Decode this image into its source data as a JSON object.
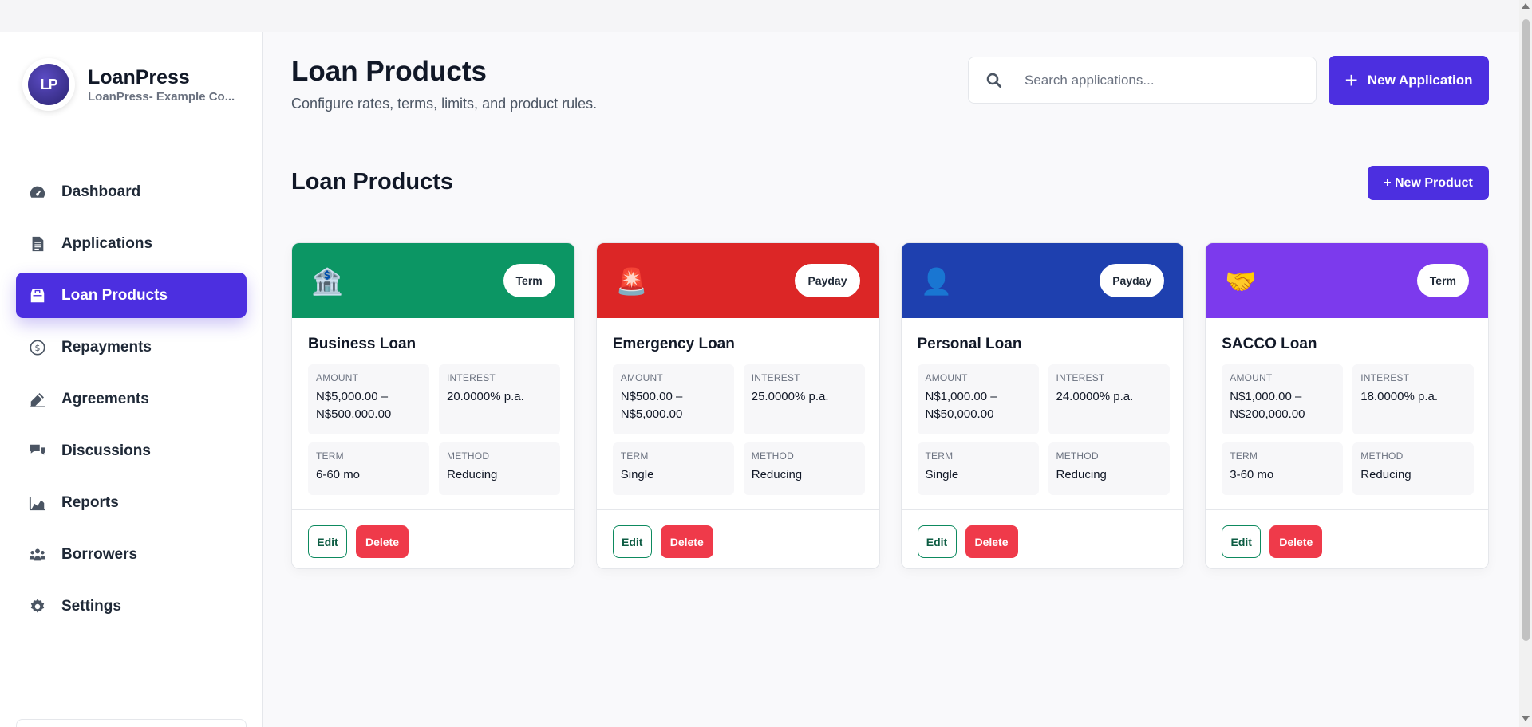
{
  "brand": {
    "logo_text": "LP",
    "name": "LoanPress",
    "subtitle": "LoanPress- Example Co..."
  },
  "sidebar": {
    "items": [
      {
        "label": "Dashboard",
        "icon": "gauge-icon",
        "active": false
      },
      {
        "label": "Applications",
        "icon": "document-icon",
        "active": false
      },
      {
        "label": "Loan Products",
        "icon": "store-icon",
        "active": true
      },
      {
        "label": "Repayments",
        "icon": "dollar-circle-icon",
        "active": false
      },
      {
        "label": "Agreements",
        "icon": "signature-icon",
        "active": false
      },
      {
        "label": "Discussions",
        "icon": "chat-icon",
        "active": false
      },
      {
        "label": "Reports",
        "icon": "chart-area-icon",
        "active": false
      },
      {
        "label": "Borrowers",
        "icon": "users-icon",
        "active": false
      },
      {
        "label": "Settings",
        "icon": "gear-icon",
        "active": false
      }
    ]
  },
  "header": {
    "title": "Loan Products",
    "subtitle": "Configure rates, terms, limits, and product rules.",
    "search_placeholder": "Search applications...",
    "new_application_label": "New Application",
    "new_application_icon": "plus-icon"
  },
  "section": {
    "title": "Loan Products",
    "new_product_label": "+ New Product"
  },
  "labels": {
    "amount": "AMOUNT",
    "interest": "INTEREST",
    "term": "TERM",
    "method": "METHOD",
    "edit": "Edit",
    "delete": "Delete"
  },
  "products": [
    {
      "name": "Business Loan",
      "badge": "Term",
      "emoji": "🏦",
      "color": "#0c9664",
      "amount": "N$5,000.00 – N$500,000.00",
      "interest": "20.0000% p.a.",
      "term": "6-60 mo",
      "method": "Reducing"
    },
    {
      "name": "Emergency Loan",
      "badge": "Payday",
      "emoji": "🚨",
      "color": "#dc2626",
      "amount": "N$500.00 – N$5,000.00",
      "interest": "25.0000% p.a.",
      "term": "Single",
      "method": "Reducing"
    },
    {
      "name": "Personal Loan",
      "badge": "Payday",
      "emoji": "👤",
      "color": "#1e40af",
      "amount": "N$1,000.00 – N$50,000.00",
      "interest": "24.0000% p.a.",
      "term": "Single",
      "method": "Reducing"
    },
    {
      "name": "SACCO Loan",
      "badge": "Term",
      "emoji": "🤝",
      "color": "#7c3aed",
      "amount": "N$1,000.00 – N$200,000.00",
      "interest": "18.0000% p.a.",
      "term": "3-60 mo",
      "method": "Reducing"
    }
  ],
  "colors": {
    "accent": "#4c2fe0",
    "danger": "#ef3a4a",
    "edit_border": "#0d8a5f"
  }
}
